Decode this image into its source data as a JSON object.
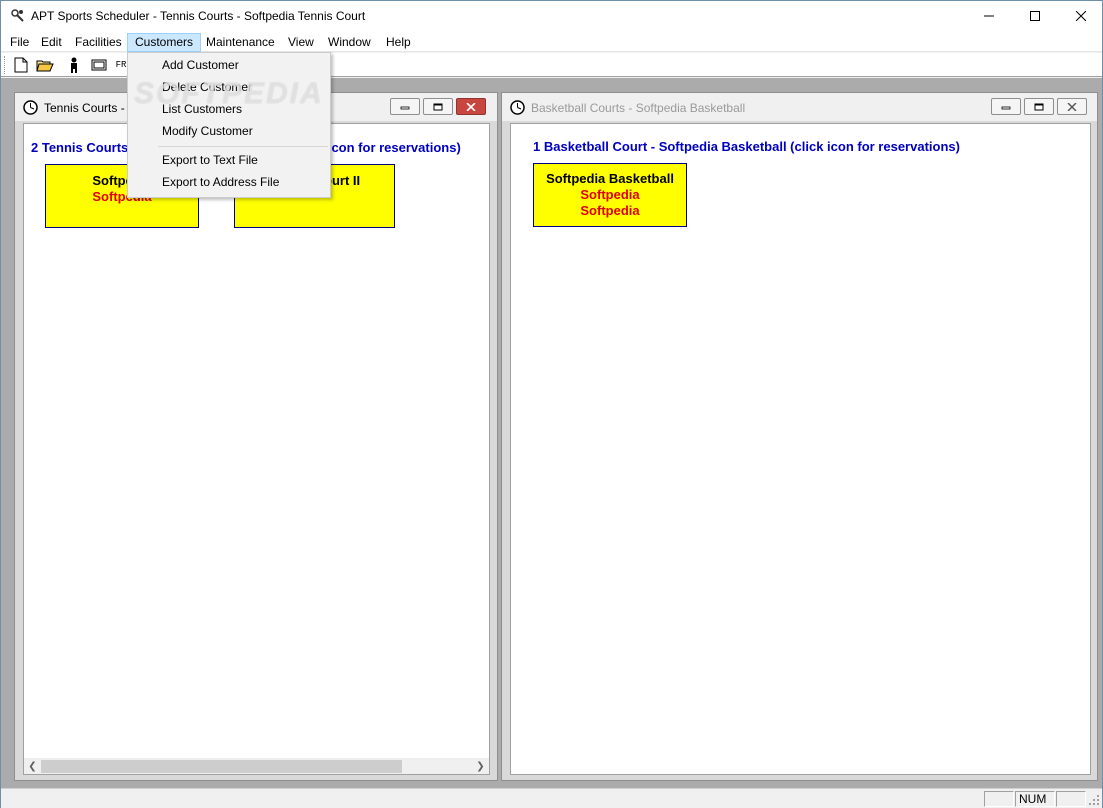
{
  "window": {
    "title": "APT Sports Scheduler - Tennis Courts - Softpedia Tennis Court"
  },
  "menubar": {
    "items": [
      "File",
      "Edit",
      "Facilities",
      "Customers",
      "Maintenance",
      "View",
      "Window",
      "Help"
    ],
    "active": "Customers"
  },
  "toolbar": {
    "icons": [
      "new-file-icon",
      "open-folder-icon",
      "person-icon",
      "window-icon",
      "fr-icon"
    ],
    "fr_label": "FR"
  },
  "customers_menu": {
    "items": [
      "Add Customer",
      "Delete Customer",
      "List Customers",
      "Modify Customer",
      "Export to Text File",
      "Export to Address File"
    ]
  },
  "tennis_window": {
    "title": "Tennis Courts -",
    "heading_left": "2 Tennis Courts",
    "heading_right": "k icon for reservations)",
    "courts": [
      {
        "name": "Softpedia",
        "sub": "Softpedia"
      },
      {
        "name": "ourt II",
        "sub": ""
      }
    ]
  },
  "basketball_window": {
    "title": "Basketball Courts - Softpedia Basketball",
    "heading": "1 Basketball Court - Softpedia Basketball  (click icon for reservations)",
    "courts": [
      {
        "name": "Softpedia Basketball",
        "sub1": "Softpedia",
        "sub2": "Softpedia"
      }
    ]
  },
  "watermark": "SOFTPEDIA",
  "statusbar": {
    "num": "NUM"
  },
  "colors": {
    "court_fill": "#ffff00",
    "heading": "#0000c0",
    "court_sub": "#e00000",
    "menu_highlight": "#cce8ff"
  }
}
